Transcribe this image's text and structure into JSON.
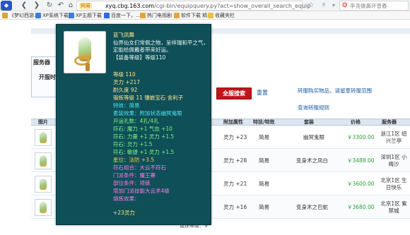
{
  "browser": {
    "badge": "网易",
    "url_host": "xyq.cbg.163.com",
    "url_path": "/cgi-bin/equipquery.py?act=show_overall_search_equip",
    "search_placeholder": "李尧做鼻环曾春"
  },
  "bookmarks": [
    {
      "label": "《梦幻西游…",
      "color": "#d7a531"
    },
    {
      "label": "XP系统下载",
      "color": "#3a7fd6"
    },
    {
      "label": "XP主题下载",
      "color": "#3a7fd6"
    },
    {
      "label": "百度一下，…",
      "color": "#2c6ae0"
    },
    {
      "label": "热门电视剧",
      "color": "#e0a73a"
    },
    {
      "label": "软件下载 精…",
      "color": "#e0a73a"
    },
    {
      "label": "收藏夹栏",
      "color": "#e8c040"
    }
  ],
  "server_filter": {
    "title": "服务器",
    "open_label": "开服时"
  },
  "actions": {
    "search_button": "全服搜索",
    "reset_link": "重置",
    "hint_link": "转服购买物品，请留意转服范围",
    "rules_link": "查询转服规则"
  },
  "table": {
    "headers": {
      "image": "图片",
      "extra_attr": "附加属性",
      "special": "特技/特效",
      "set": "套装",
      "price": "价格",
      "server": "服务器"
    },
    "rows": [
      {
        "extra": "灵力 +23",
        "special": "简易",
        "set": "幽冥鬼眼",
        "price": "￥3300.00",
        "server": "浙江1区 绍兴兰亭"
      },
      {
        "extra": "灵力 +28",
        "special": "简易",
        "set": "变身术之凤白",
        "price": "￥3488.00",
        "server": "深圳1区 小梅沙"
      },
      {
        "extra": "灵力 +21",
        "special": "简易",
        "set": "",
        "price": "￥3600.00",
        "server": "北京1区 生日快乐"
      },
      {
        "extra": "灵力 +16",
        "special": "简易",
        "set": "变身术之巴蛇",
        "price": "￥3680.00",
        "server": "北京1区 紫禁城"
      }
    ],
    "footer_text": "锻炼等级：9"
  },
  "tooltip": {
    "name": "蓝飞凤舞",
    "desc1": "仙界仙女们常佩之物，呈祥瑞和平之气，",
    "desc2": "定能给佩戴者带来好运。",
    "req": "【装备等级】等级110",
    "level": "等级 110",
    "spirit": "灵力 +217",
    "durability": "耐久度 92",
    "forge": "锻炼等级 11 镶嵌宝石 舍利子",
    "special": "特效：简易",
    "set_effect": "套装效果：附加状态幽冥鬼眼",
    "open_slots": "开运孔数：4孔/4孔",
    "gem1": "符石: 魔力 +1 气血 +10",
    "gem2": "符石: 力量 +1 灵力 +1.5",
    "gem3": "符石: 灵力 +1.5",
    "gem4": "符石: 敏捷 +1 灵力 +1.5",
    "stars": "星位：法防 +3.5",
    "combo": "符石组合：大云不符石",
    "sect_req": "门派条件：魔王寨",
    "slot_req": "部位条件：项链",
    "effect": "增加门派技能大云术4级",
    "smelt": "熔炼效果：",
    "bonus": "+23灵力"
  }
}
